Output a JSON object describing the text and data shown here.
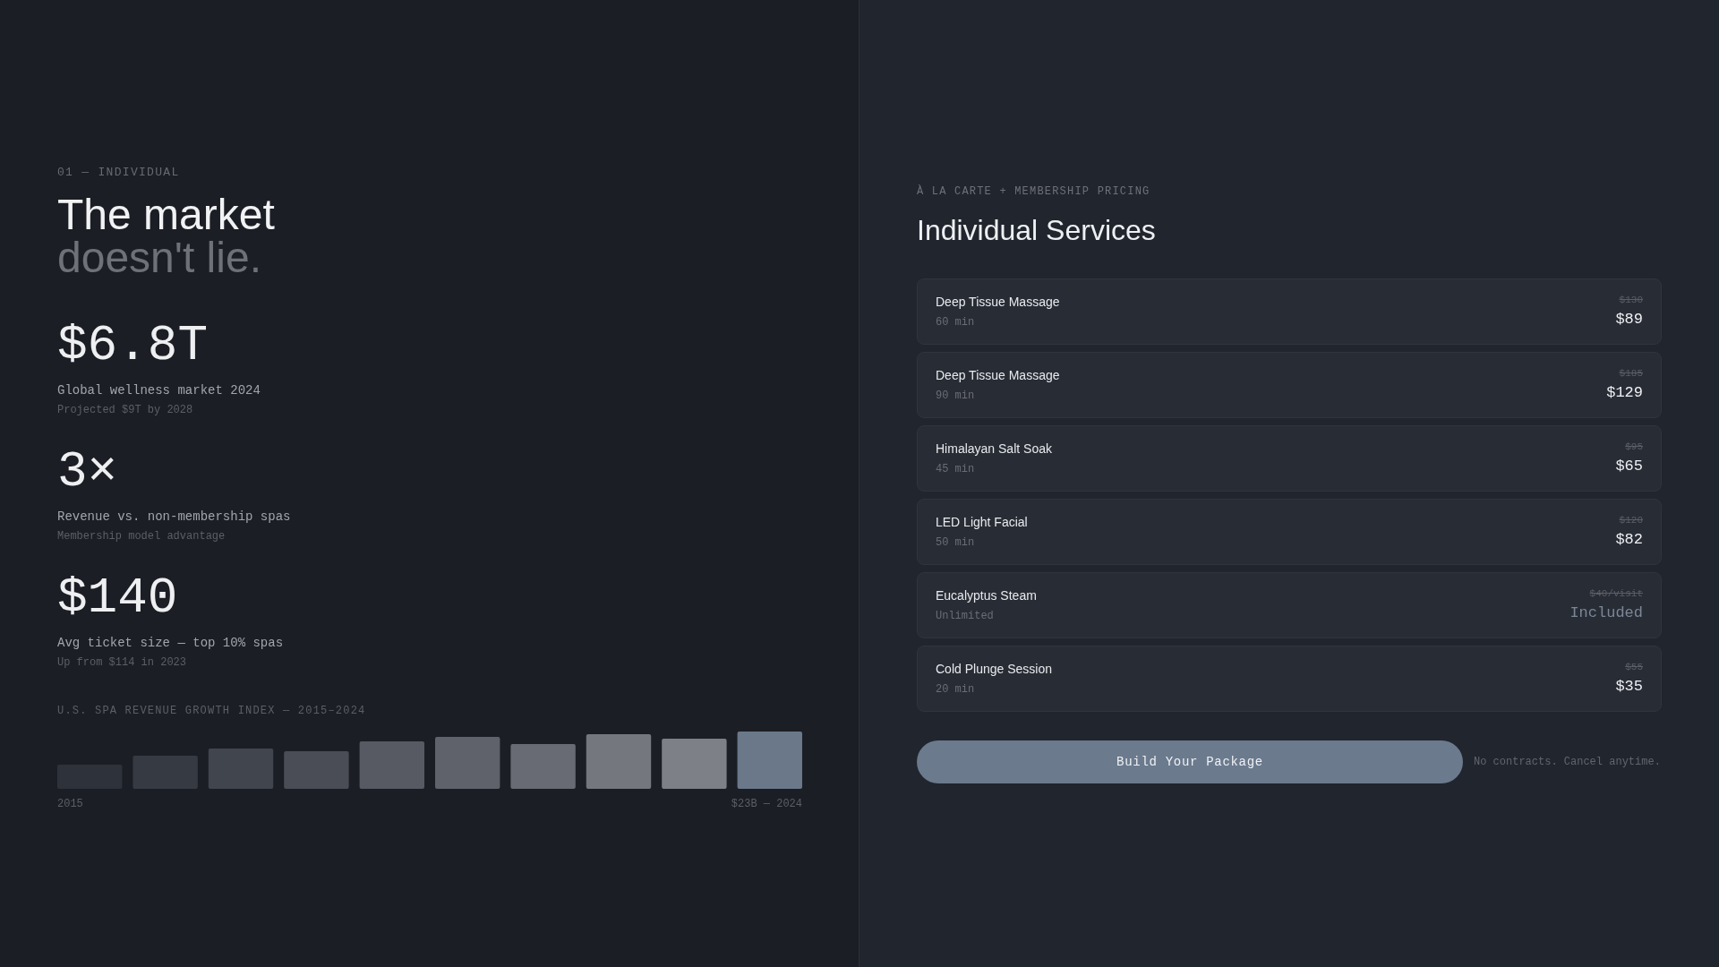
{
  "left": {
    "eyebrow": "01 — INDIVIDUAL",
    "title_line1": "The market",
    "title_line2": "doesn't lie.",
    "stats": [
      {
        "value": "$6.8T",
        "label": "Global wellness market 2024",
        "note": "Projected $9T by 2028"
      },
      {
        "value": "3×",
        "label": "Revenue vs. non-membership spas",
        "note": "Membership model advantage"
      },
      {
        "value": "$140",
        "label": "Avg ticket size — top 10% spas",
        "note": "Up from $114 in 2023"
      }
    ],
    "growth": {
      "title": "U.S. SPA REVENUE GROWTH INDEX — 2015–2024",
      "start_label": "2015",
      "end_label": "$23B — 2024"
    }
  },
  "right": {
    "eyebrow": "À LA CARTE + MEMBERSHIP PRICING",
    "title": "Individual Services",
    "services": [
      {
        "name": "Deep Tissue Massage",
        "duration": "60 min",
        "old_price": "$130",
        "price": "$89",
        "kind": "price"
      },
      {
        "name": "Deep Tissue Massage",
        "duration": "90 min",
        "old_price": "$185",
        "price": "$129",
        "kind": "price"
      },
      {
        "name": "Himalayan Salt Soak",
        "duration": "45 min",
        "old_price": "$95",
        "price": "$65",
        "kind": "price"
      },
      {
        "name": "LED Light Facial",
        "duration": "50 min",
        "old_price": "$120",
        "price": "$82",
        "kind": "price"
      },
      {
        "name": "Eucalyptus Steam",
        "duration": "Unlimited",
        "old_price": "$40/visit",
        "price": "Included",
        "kind": "included"
      },
      {
        "name": "Cold Plunge Session",
        "duration": "20 min",
        "old_price": "$55",
        "price": "$35",
        "kind": "price"
      }
    ],
    "button": "Build Your Package",
    "note": "No contracts. Cancel anytime."
  }
}
